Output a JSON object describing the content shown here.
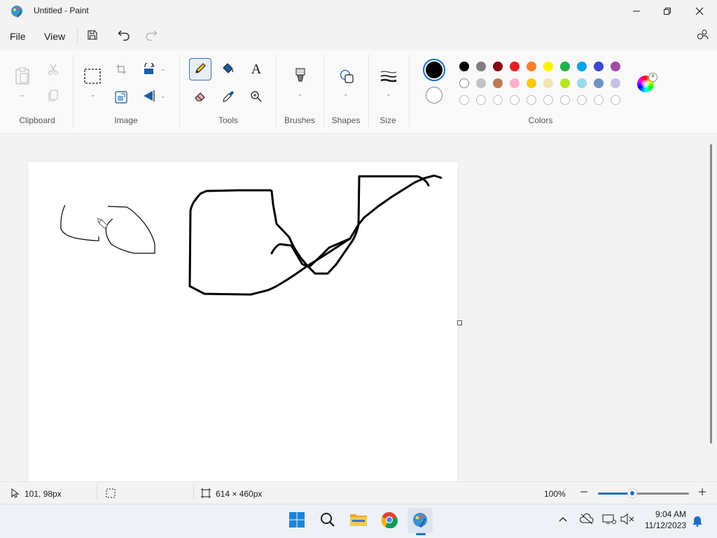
{
  "window": {
    "title": "Untitled - Paint"
  },
  "menu": {
    "file": "File",
    "view": "View"
  },
  "ribbon": {
    "groups": {
      "clipboard": "Clipboard",
      "image": "Image",
      "tools": "Tools",
      "brushes": "Brushes",
      "shapes": "Shapes",
      "size": "Size",
      "colors": "Colors"
    },
    "text_tool_glyph": "A",
    "selected_tool": "pencil",
    "primary_color": "#000000",
    "secondary_color": "#ffffff",
    "palette_row1": [
      "#000000",
      "#7f7f7f",
      "#880015",
      "#ed1c24",
      "#ff7f27",
      "#fff200",
      "#22b14c",
      "#00a2e8",
      "#3f48cc",
      "#a349a4"
    ],
    "palette_row2": [
      "#ffffff",
      "#c3c3c3",
      "#b97a57",
      "#ffaec9",
      "#ffc90e",
      "#efe4b0",
      "#b5e61d",
      "#99d9ea",
      "#7092be",
      "#c8bfe7"
    ]
  },
  "status": {
    "cursor_pos": "101, 98px",
    "canvas_size": "614 × 460px",
    "zoom": "100%",
    "zoom_slider_fraction": 0.38
  },
  "taskbar": {
    "time": "9:04 AM",
    "date": "11/12/2023"
  }
}
